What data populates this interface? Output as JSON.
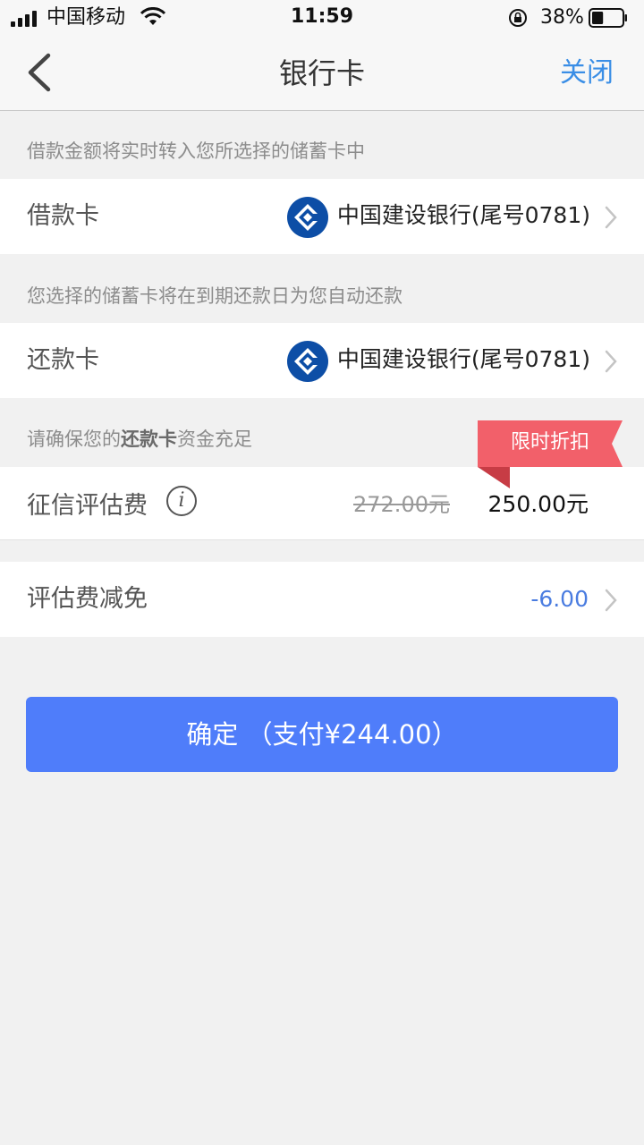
{
  "status_bar": {
    "carrier": "中国移动",
    "time": "11:59",
    "battery_percent": "38%",
    "battery_level": 0.38
  },
  "nav": {
    "title": "银行卡",
    "close_label": "关闭",
    "back_icon": "chevron-left-icon"
  },
  "loan_section": {
    "hint": "借款金额将实时转入您所选择的储蓄卡中",
    "label": "借款卡",
    "bank_name": "中国建设银行(尾号0781)"
  },
  "repay_section": {
    "hint": "您选择的储蓄卡将在到期还款日为您自动还款",
    "label": "还款卡",
    "bank_name": "中国建设银行(尾号0781)"
  },
  "fee_section": {
    "hint_prefix": "请确保您的",
    "hint_bold": "还款卡",
    "hint_suffix": "资金充足",
    "badge": "限时折扣",
    "label": "征信评估费",
    "info_glyph": "i",
    "old_price": "272.00元",
    "new_price": "250.00元"
  },
  "discount": {
    "label": "评估费减免",
    "value": "-6.00"
  },
  "confirm": {
    "label": "确定 （支付¥244.00）"
  },
  "colors": {
    "accent": "#4f7dfa",
    "link": "#3a8ee6",
    "badge": "#f2606a",
    "bank_blue": "#0d4ea6"
  }
}
